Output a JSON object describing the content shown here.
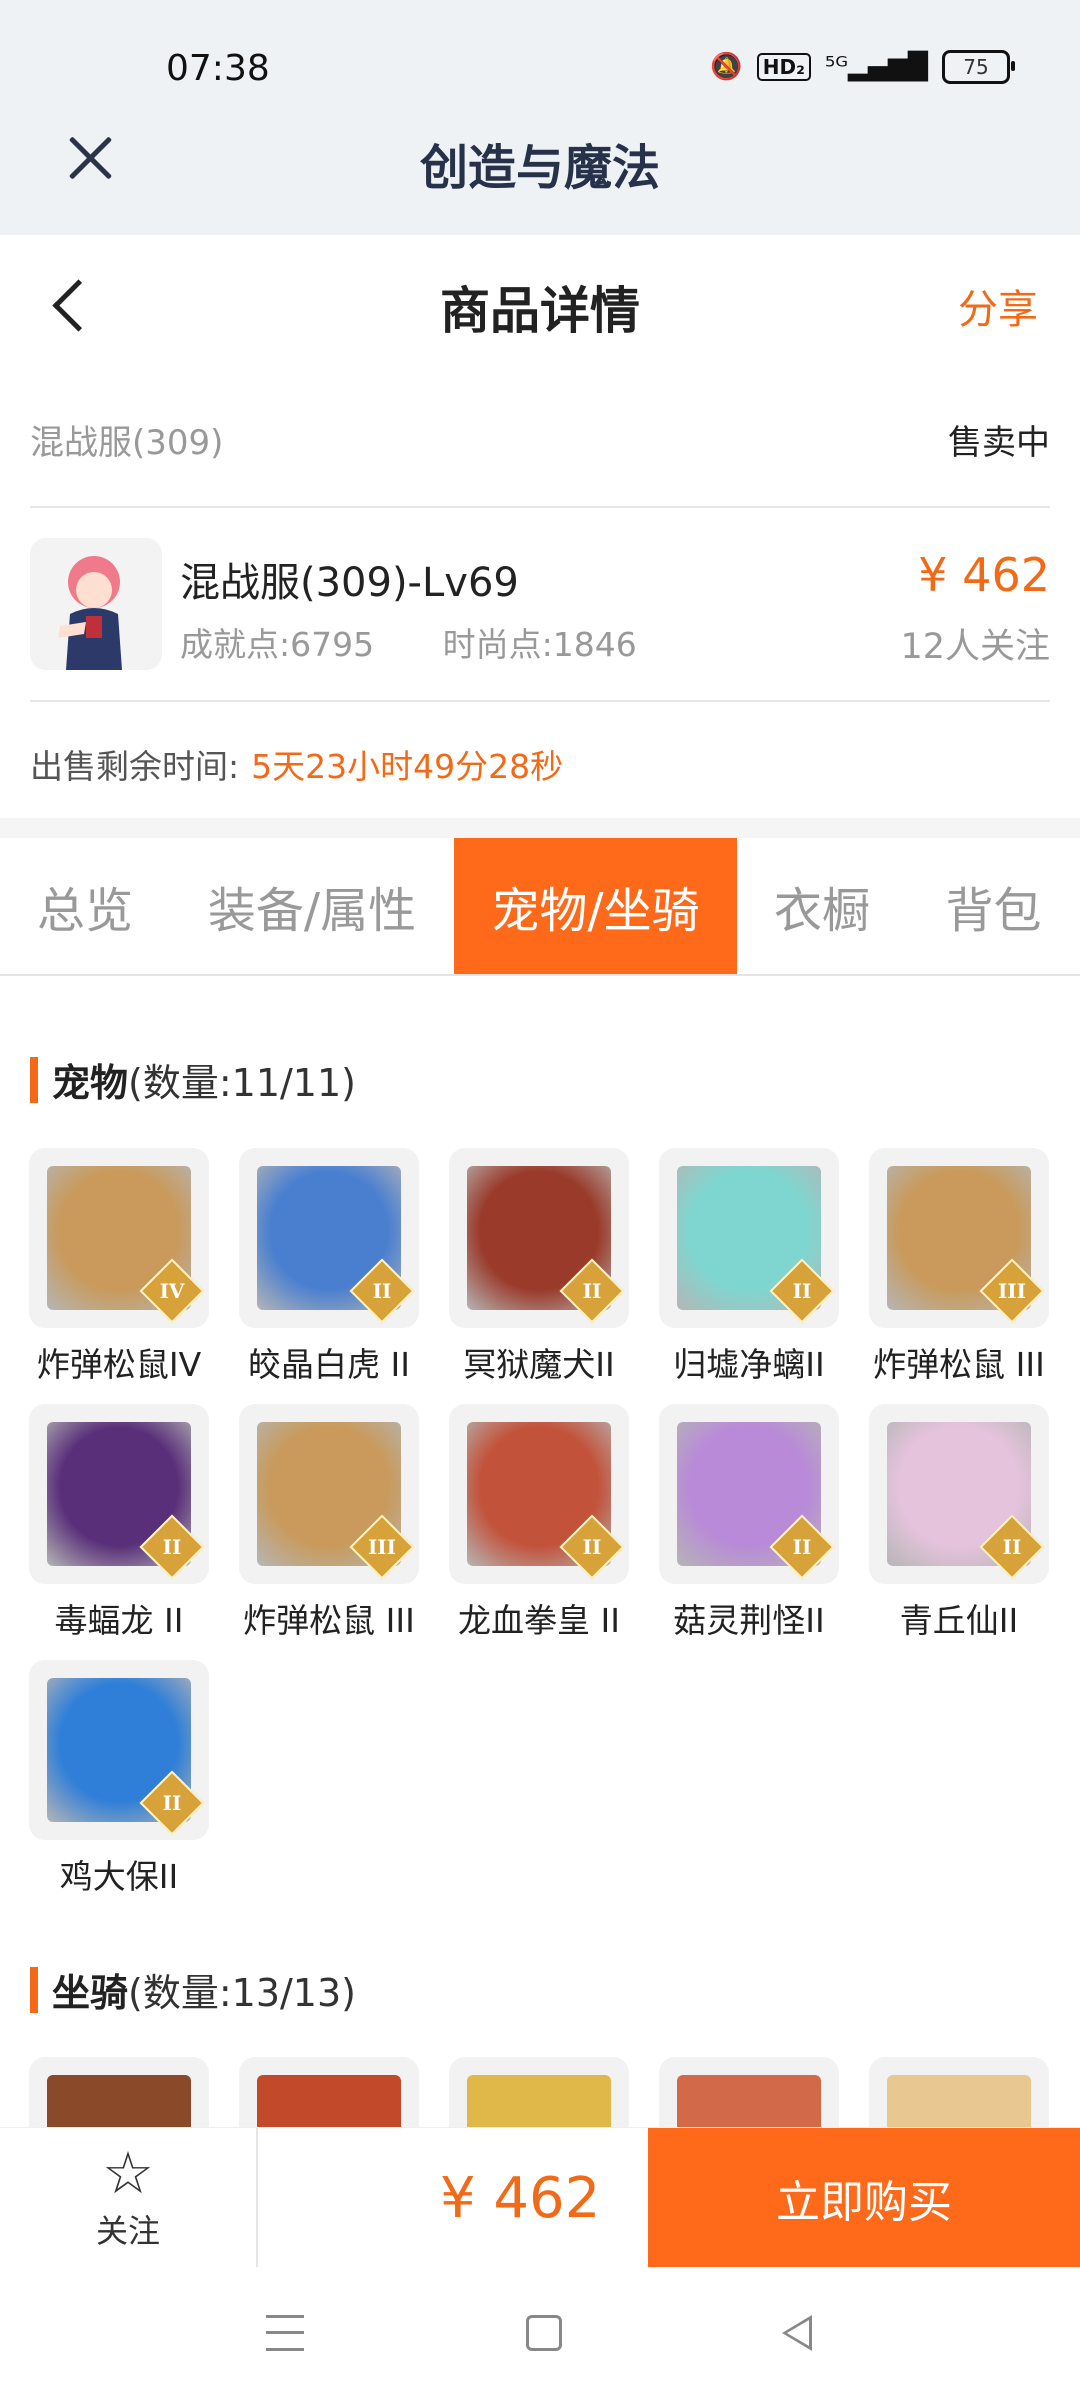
{
  "status_bar": {
    "time": "07:38",
    "icons": [
      "bell-muted-icon",
      "hd-icon",
      "signal-5g-icon"
    ],
    "hd_text": "HD₂",
    "signal_text": "⁵ᴳ▂▄▆█",
    "battery": "75"
  },
  "app": {
    "title": "创造与魔法"
  },
  "nav": {
    "title": "商品详情",
    "share": "分享"
  },
  "listing": {
    "server": "混战服(309)",
    "status": "售卖中",
    "name": "混战服(309)-Lv69",
    "achievement": "成就点:6795",
    "fashion": "时尚点:1846",
    "price": "¥ 462",
    "followers": "12人关注",
    "time_left_label": "出售剩余时间:",
    "time_left_value": "5天23小时49分28秒"
  },
  "tabs": [
    {
      "label": "总览",
      "active": false
    },
    {
      "label": "装备/属性",
      "active": false
    },
    {
      "label": "宠物/坐骑",
      "active": true
    },
    {
      "label": "衣橱",
      "active": false
    },
    {
      "label": "背包",
      "active": false
    }
  ],
  "pets_section": {
    "title": "宠物",
    "count": "(数量:11/11)"
  },
  "pets": [
    {
      "name": "炸弹松鼠IV",
      "badge": "IV",
      "color": "#c99a5b"
    },
    {
      "name": "皎晶白虎 II",
      "badge": "II",
      "color": "#4a7fd0"
    },
    {
      "name": "冥狱魔犬II",
      "badge": "II",
      "color": "#9a3a2a"
    },
    {
      "name": "归墟净螭II",
      "badge": "II",
      "color": "#7fd6d0"
    },
    {
      "name": "炸弹松鼠 III",
      "badge": "III",
      "color": "#c99a5b"
    },
    {
      "name": "毒蝠龙 II",
      "badge": "II",
      "color": "#5a2f7a"
    },
    {
      "name": "炸弹松鼠 III",
      "badge": "III",
      "color": "#c99a5b"
    },
    {
      "name": "龙血拳皇 II",
      "badge": "II",
      "color": "#c2523a"
    },
    {
      "name": "菇灵荆怪II",
      "badge": "II",
      "color": "#b98ad8"
    },
    {
      "name": "青丘仙II",
      "badge": "II",
      "color": "#e6c3dd"
    },
    {
      "name": "鸡大保II",
      "badge": "II",
      "color": "#2f7fd8"
    }
  ],
  "mounts_section": {
    "title": "坐骑",
    "count": "(数量:13/13)"
  },
  "mounts_preview_colors": [
    "#8a4a2a",
    "#c24a2a",
    "#e0b84a",
    "#d26a4a",
    "#e8c890"
  ],
  "bottom": {
    "follow": "关注",
    "price": "¥ 462",
    "buy": "立即购买"
  },
  "colors": {
    "accent": "#f26a17",
    "tab_active": "#ff6a1a"
  }
}
